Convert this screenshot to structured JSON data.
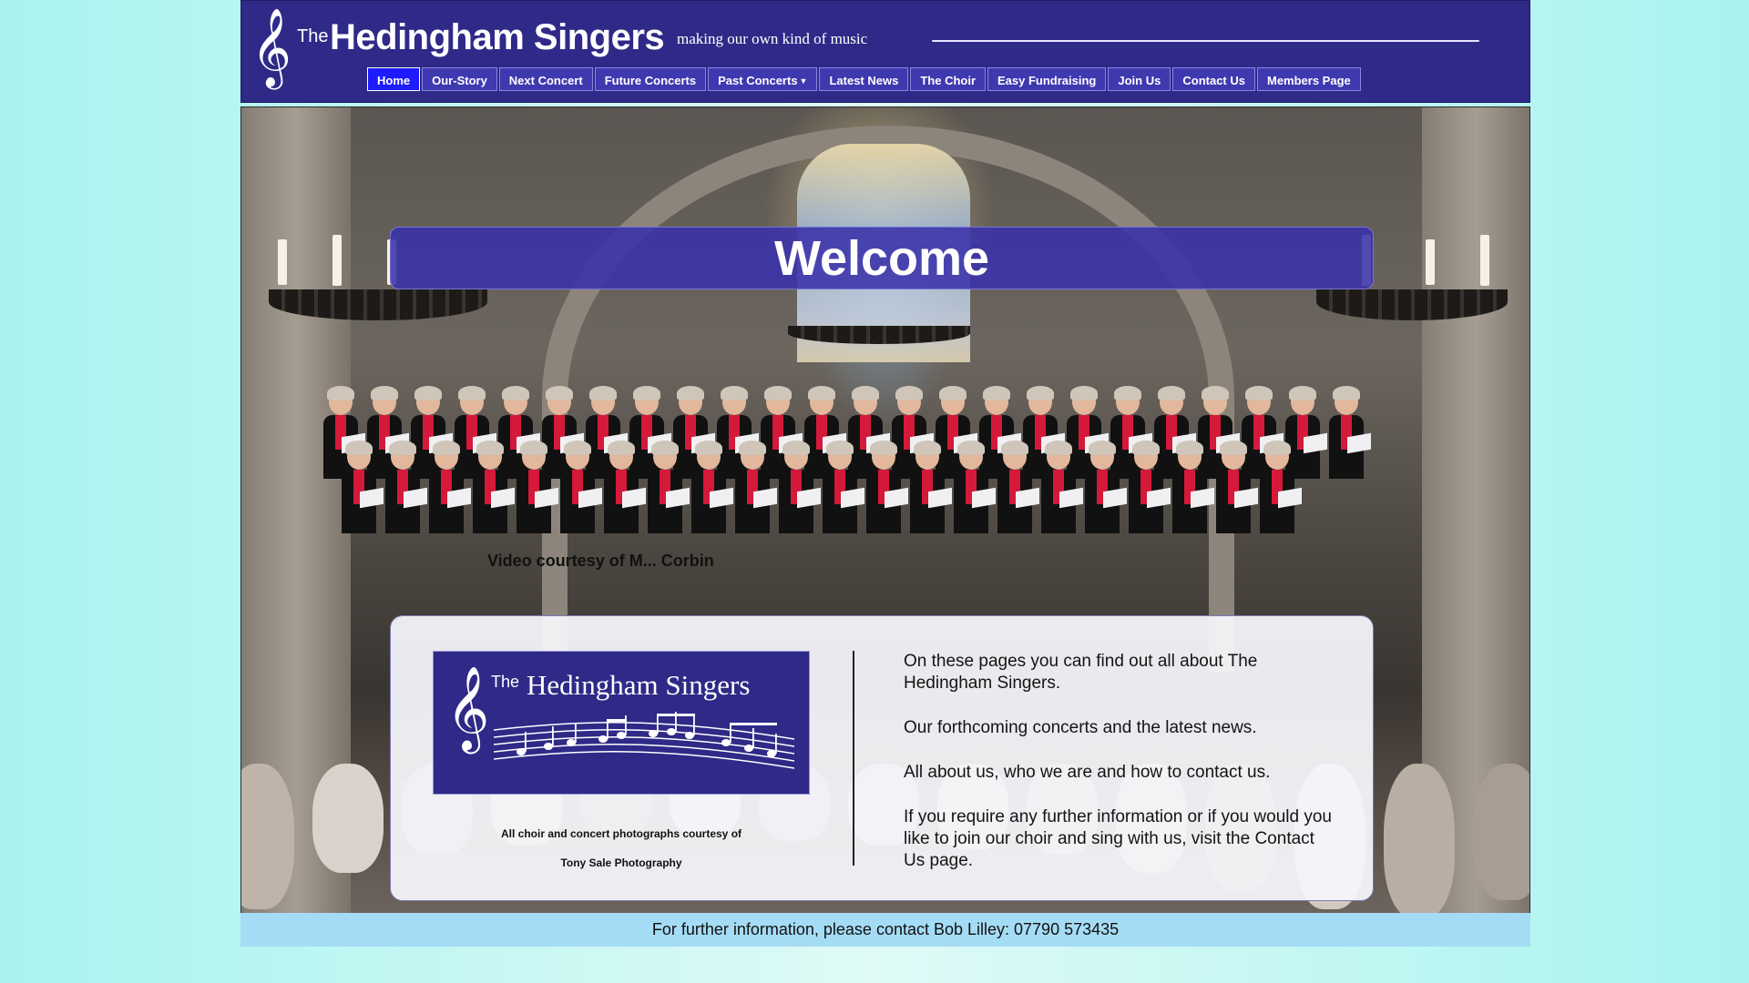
{
  "header": {
    "brand_the": "The",
    "brand_name": "Hedingham Singers",
    "tagline": "making our own kind of music",
    "clef_icon": "treble-clef-icon"
  },
  "nav": {
    "items": [
      {
        "label": "Home",
        "active": true
      },
      {
        "label": "Our-Story"
      },
      {
        "label": "Next Concert"
      },
      {
        "label": "Future Concerts"
      },
      {
        "label": "Past Concerts",
        "has_dropdown": true
      },
      {
        "label": "Latest News"
      },
      {
        "label": "The Choir"
      },
      {
        "label": "Easy Fundraising"
      },
      {
        "label": "Join Us"
      },
      {
        "label": "Contact Us"
      },
      {
        "label": "Members Page"
      }
    ]
  },
  "hero": {
    "welcome": "Welcome",
    "video_credit": "Video courtesy of M... Corbin"
  },
  "panel": {
    "logo_the": "The",
    "logo_name": "Hedingham Singers",
    "photo_credit_line1": "All choir and concert photographs courtesy of",
    "photo_credit_line2": "Tony Sale  Photography",
    "paragraphs": [
      "On these pages you can find out all about The Hedingham Singers.",
      "Our forthcoming concerts and the latest news.",
      "All about us, who we are and how to contact us.",
      "If you require any further information or if you would you like to join our choir and sing with us, visit the Contact Us page."
    ]
  },
  "footer": {
    "text": "For further information, please contact Bob Lilley:  07790 573435"
  },
  "colors": {
    "header_bg": "#2f2a87",
    "nav_bg": "#3f39b0",
    "nav_active": "#1e1cff",
    "page_bg": "#a8f3ef",
    "footer_bg": "#a5dcf5"
  }
}
